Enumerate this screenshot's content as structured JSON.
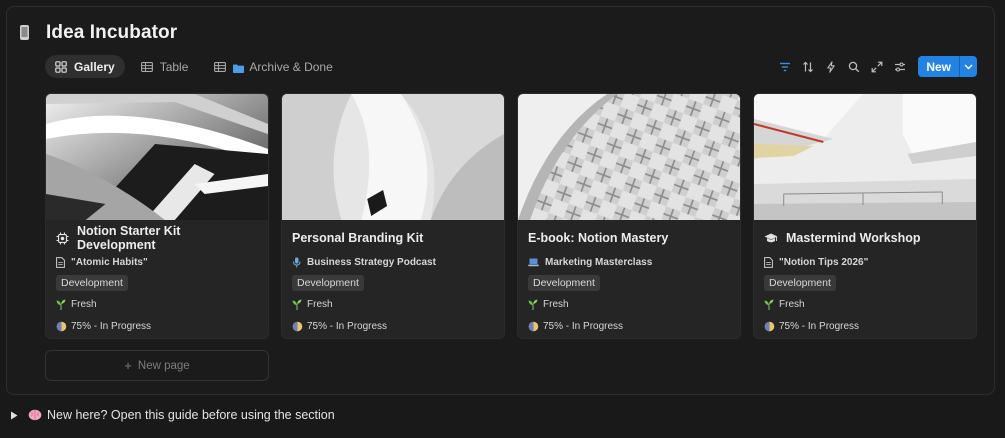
{
  "page": {
    "title": "Idea Incubator",
    "title_icon": "phone-icon"
  },
  "tabs": [
    {
      "label": "Gallery",
      "icon": "gallery-icon",
      "active": true
    },
    {
      "label": "Table",
      "icon": "table-icon",
      "active": false
    },
    {
      "label": "Archive & Done",
      "icon": "table-icon",
      "prefix_icon": "folder-icon",
      "active": false
    }
  ],
  "toolbar": {
    "icons": [
      "filter-icon",
      "sort-icon",
      "lightning-icon",
      "search-icon",
      "expand-icon",
      "settings-sliders-icon"
    ],
    "new_label": "New",
    "accent": "#2383e2"
  },
  "cards": [
    {
      "title": "Notion Starter Kit Development",
      "title_icon": "gear-chip-icon",
      "relation": "\"Atomic Habits\"",
      "relation_icon": "document-icon",
      "tag": "Development",
      "status": "Fresh",
      "status_icon": "seedling-icon",
      "progress": "75% - In Progress",
      "progress_icon": "half-circle-icon"
    },
    {
      "title": "Personal Branding Kit",
      "title_icon": "",
      "relation": "Business Strategy Podcast",
      "relation_icon": "microphone-icon",
      "tag": "Development",
      "status": "Fresh",
      "status_icon": "seedling-icon",
      "progress": "75% - In Progress",
      "progress_icon": "half-circle-icon"
    },
    {
      "title": "E-book: Notion Mastery",
      "title_icon": "",
      "relation": "Marketing Masterclass",
      "relation_icon": "laptop-icon",
      "tag": "Development",
      "status": "Fresh",
      "status_icon": "seedling-icon",
      "progress": "75% - In Progress",
      "progress_icon": "half-circle-icon"
    },
    {
      "title": "Mastermind Workshop",
      "title_icon": "graduation-cap-icon",
      "relation": "\"Notion Tips 2026\"",
      "relation_icon": "document-icon",
      "tag": "Development",
      "status": "Fresh",
      "status_icon": "seedling-icon",
      "progress": "75% - In Progress",
      "progress_icon": "half-circle-icon"
    }
  ],
  "new_page": {
    "label": "New page"
  },
  "toggle": {
    "label": "New here? Open this guide before using the section",
    "icon": "brain-icon"
  }
}
